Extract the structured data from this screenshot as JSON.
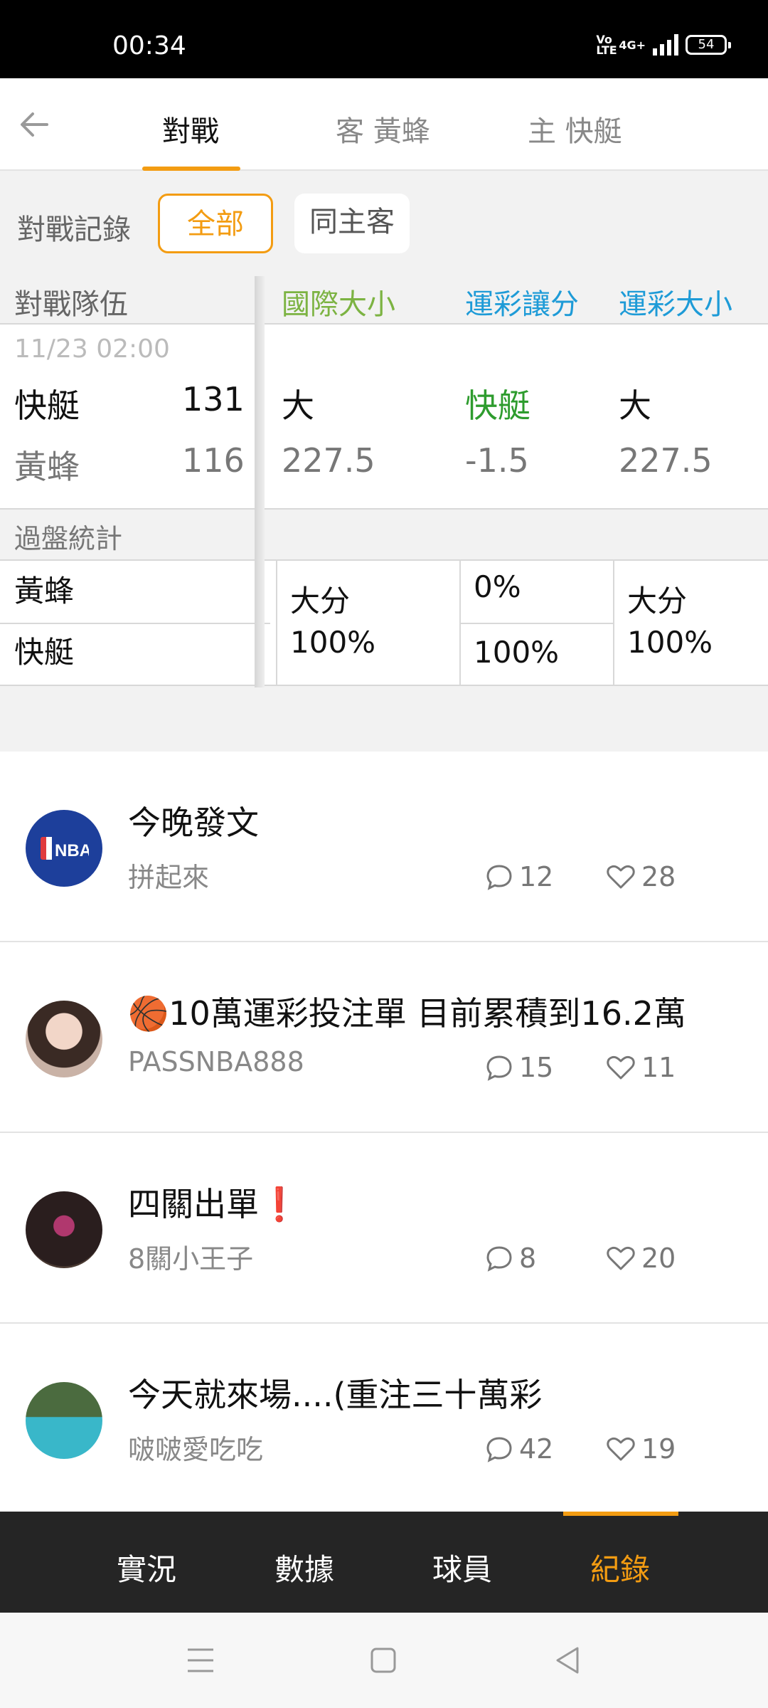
{
  "status_bar": {
    "time": "00:34",
    "volte": "Vo LTE",
    "network": "4G+",
    "battery": "54"
  },
  "top_nav": {
    "tabs": [
      {
        "label": "對戰",
        "active": true
      },
      {
        "label": "客 黃蜂",
        "active": false
      },
      {
        "label": "主 快艇",
        "active": false
      }
    ]
  },
  "filter": {
    "label": "對戰記錄",
    "options": [
      "全部",
      "同主客"
    ],
    "selected": "全部"
  },
  "table": {
    "headers": {
      "team": "對戰隊伍",
      "intl_total": "國際大小",
      "spread": "運彩讓分",
      "sports_total": "運彩大小"
    },
    "header_colors": {
      "intl_total": "#7cb342",
      "spread": "#1e9bd7",
      "sports_total": "#1e9bd7"
    },
    "game": {
      "datetime": "11/23 02:00",
      "home": {
        "team": "快艇",
        "score": "131"
      },
      "away": {
        "team": "黃蜂",
        "score": "116"
      },
      "intl_total": {
        "result": "大",
        "line": "227.5"
      },
      "spread": {
        "result": "快艇",
        "line": "-1.5",
        "result_color": "#2e9c2e"
      },
      "sports_total": {
        "result": "大",
        "line": "227.5"
      }
    },
    "summary": {
      "label": "過盤統計",
      "teams": [
        "黃蜂",
        "快艇"
      ],
      "intl_total": {
        "label": "大分",
        "pct": "100%"
      },
      "spread": {
        "top": "0%",
        "bottom": "100%"
      },
      "sports_total": {
        "label": "大分",
        "pct": "100%"
      }
    }
  },
  "posts": [
    {
      "title": "今晚發文",
      "author": "拼起來",
      "comments": "12",
      "likes": "28",
      "avatar": "nba-logo"
    },
    {
      "title": "🏀10萬運彩投注單 目前累積到16.2萬",
      "author": "PASSNBA888",
      "comments": "15",
      "likes": "11",
      "avatar": "user-photo"
    },
    {
      "title": "四關出單❗",
      "author": "8關小王子",
      "comments": "8",
      "likes": "20",
      "avatar": "car-photo"
    },
    {
      "title": "今天就來場....(重注三十萬彩",
      "author": "啵啵愛吃吃",
      "comments": "42",
      "likes": "19",
      "avatar": "pool-photo"
    }
  ],
  "bottom_nav": {
    "tabs": [
      {
        "label": "實況",
        "active": false
      },
      {
        "label": "數據",
        "active": false
      },
      {
        "label": "球員",
        "active": false
      },
      {
        "label": "紀錄",
        "active": true
      }
    ]
  },
  "nba_logo_text": "NBA",
  "accent_color": "#f39c12"
}
